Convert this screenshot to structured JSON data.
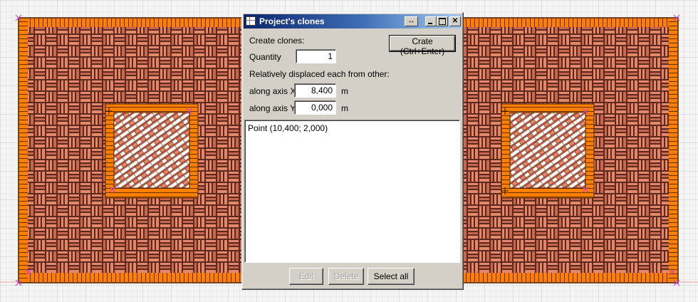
{
  "dialog": {
    "title": "Project's clones",
    "title_buttons": {
      "swap": "↔"
    },
    "create_clones_label": "Create clones:",
    "create_button": "Crate (Ctrl+Enter)",
    "quantity_label": "Quantity",
    "quantity_value": "1",
    "displaced_label": "Relatively displaced each from other:",
    "axis_x_label": "along axis X",
    "axis_x_value": "8,400",
    "axis_x_unit": "m",
    "axis_y_label": "along axis Y",
    "axis_y_value": "0,000",
    "axis_y_unit": "m",
    "points": [
      "Point (10,400; 2,000)"
    ],
    "buttons": {
      "edit": "Edit",
      "delete": "Delete",
      "select_all": "Select all"
    }
  },
  "colors": {
    "grid_background": "#f4f4f4",
    "grid_line": "#dadada",
    "brick_border": "#ff8000",
    "brick_main": "#e8866a",
    "brick_dark": "#7a3a2a",
    "marker": "#cc44cc",
    "dialog_face": "#d4d0c8",
    "titlebar_start": "#0a246a",
    "titlebar_end": "#a6caf0"
  }
}
